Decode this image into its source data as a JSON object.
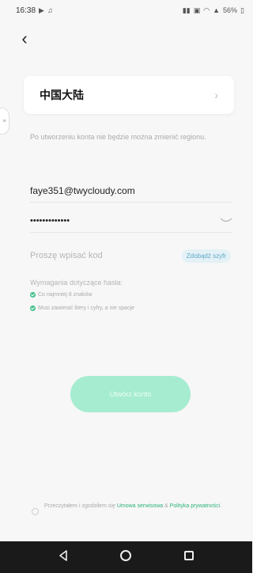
{
  "status_bar": {
    "time": "16:38",
    "battery": "56%"
  },
  "region": {
    "name": "中国大陆",
    "note": "Po utworzeniu konta nie będzie można zmienić regionu."
  },
  "form": {
    "email": "faye351@twycloudy.com",
    "password_masked": "•••••••••••••",
    "code_placeholder": "Proszę wpisać kod",
    "code_button": "Zdobądź szyfr"
  },
  "requirements": {
    "title": "Wymagania dotyczące hasła:",
    "items": [
      "Co najmniej 8 znaków",
      "Musi zawierać litery i cyfry, a nie spacje"
    ]
  },
  "create_button": "Utwórz konto",
  "terms": {
    "prefix": "Przeczytałem i zgodziłem się ",
    "service_link": "Umowa serwisowa",
    "connector": " & ",
    "privacy_link": "Polityka prywatności",
    "suffix": "."
  },
  "icons": {
    "back": "chevron-left-icon",
    "region_arrow": "chevron-right-icon",
    "password_toggle": "eye-closed-icon"
  },
  "colors": {
    "accent": "#2db37a",
    "button_disabled": "#a6ecd1",
    "code_button_text": "#5fa9c9"
  }
}
